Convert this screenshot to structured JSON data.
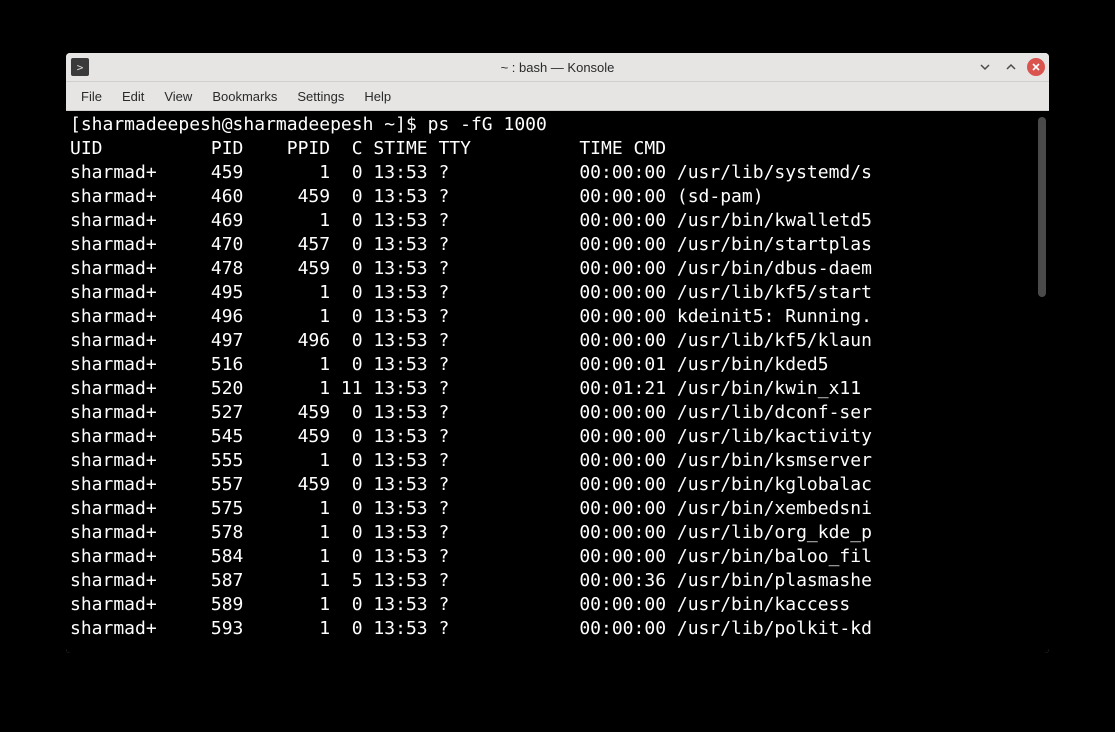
{
  "window": {
    "title": "~ : bash — Konsole",
    "app_icon_glyph": ">"
  },
  "menubar": {
    "items": [
      "File",
      "Edit",
      "View",
      "Bookmarks",
      "Settings",
      "Help"
    ]
  },
  "terminal": {
    "prompt": "[sharmadeepesh@sharmadeepesh ~]$ ",
    "command": "ps -fG 1000",
    "header": "UID          PID    PPID  C STIME TTY          TIME CMD",
    "rows": [
      {
        "uid": "sharmad+",
        "pid": "459",
        "ppid": "1",
        "c": "0",
        "stime": "13:53",
        "tty": "?",
        "time": "00:00:00",
        "cmd": "/usr/lib/systemd/s"
      },
      {
        "uid": "sharmad+",
        "pid": "460",
        "ppid": "459",
        "c": "0",
        "stime": "13:53",
        "tty": "?",
        "time": "00:00:00",
        "cmd": "(sd-pam)"
      },
      {
        "uid": "sharmad+",
        "pid": "469",
        "ppid": "1",
        "c": "0",
        "stime": "13:53",
        "tty": "?",
        "time": "00:00:00",
        "cmd": "/usr/bin/kwalletd5"
      },
      {
        "uid": "sharmad+",
        "pid": "470",
        "ppid": "457",
        "c": "0",
        "stime": "13:53",
        "tty": "?",
        "time": "00:00:00",
        "cmd": "/usr/bin/startplas"
      },
      {
        "uid": "sharmad+",
        "pid": "478",
        "ppid": "459",
        "c": "0",
        "stime": "13:53",
        "tty": "?",
        "time": "00:00:00",
        "cmd": "/usr/bin/dbus-daem"
      },
      {
        "uid": "sharmad+",
        "pid": "495",
        "ppid": "1",
        "c": "0",
        "stime": "13:53",
        "tty": "?",
        "time": "00:00:00",
        "cmd": "/usr/lib/kf5/start"
      },
      {
        "uid": "sharmad+",
        "pid": "496",
        "ppid": "1",
        "c": "0",
        "stime": "13:53",
        "tty": "?",
        "time": "00:00:00",
        "cmd": "kdeinit5: Running."
      },
      {
        "uid": "sharmad+",
        "pid": "497",
        "ppid": "496",
        "c": "0",
        "stime": "13:53",
        "tty": "?",
        "time": "00:00:00",
        "cmd": "/usr/lib/kf5/klaun"
      },
      {
        "uid": "sharmad+",
        "pid": "516",
        "ppid": "1",
        "c": "0",
        "stime": "13:53",
        "tty": "?",
        "time": "00:00:01",
        "cmd": "/usr/bin/kded5"
      },
      {
        "uid": "sharmad+",
        "pid": "520",
        "ppid": "1",
        "c": "11",
        "stime": "13:53",
        "tty": "?",
        "time": "00:01:21",
        "cmd": "/usr/bin/kwin_x11"
      },
      {
        "uid": "sharmad+",
        "pid": "527",
        "ppid": "459",
        "c": "0",
        "stime": "13:53",
        "tty": "?",
        "time": "00:00:00",
        "cmd": "/usr/lib/dconf-ser"
      },
      {
        "uid": "sharmad+",
        "pid": "545",
        "ppid": "459",
        "c": "0",
        "stime": "13:53",
        "tty": "?",
        "time": "00:00:00",
        "cmd": "/usr/lib/kactivity"
      },
      {
        "uid": "sharmad+",
        "pid": "555",
        "ppid": "1",
        "c": "0",
        "stime": "13:53",
        "tty": "?",
        "time": "00:00:00",
        "cmd": "/usr/bin/ksmserver"
      },
      {
        "uid": "sharmad+",
        "pid": "557",
        "ppid": "459",
        "c": "0",
        "stime": "13:53",
        "tty": "?",
        "time": "00:00:00",
        "cmd": "/usr/bin/kglobalac"
      },
      {
        "uid": "sharmad+",
        "pid": "575",
        "ppid": "1",
        "c": "0",
        "stime": "13:53",
        "tty": "?",
        "time": "00:00:00",
        "cmd": "/usr/bin/xembedsni"
      },
      {
        "uid": "sharmad+",
        "pid": "578",
        "ppid": "1",
        "c": "0",
        "stime": "13:53",
        "tty": "?",
        "time": "00:00:00",
        "cmd": "/usr/lib/org_kde_p"
      },
      {
        "uid": "sharmad+",
        "pid": "584",
        "ppid": "1",
        "c": "0",
        "stime": "13:53",
        "tty": "?",
        "time": "00:00:00",
        "cmd": "/usr/bin/baloo_fil"
      },
      {
        "uid": "sharmad+",
        "pid": "587",
        "ppid": "1",
        "c": "5",
        "stime": "13:53",
        "tty": "?",
        "time": "00:00:36",
        "cmd": "/usr/bin/plasmashe"
      },
      {
        "uid": "sharmad+",
        "pid": "589",
        "ppid": "1",
        "c": "0",
        "stime": "13:53",
        "tty": "?",
        "time": "00:00:00",
        "cmd": "/usr/bin/kaccess"
      },
      {
        "uid": "sharmad+",
        "pid": "593",
        "ppid": "1",
        "c": "0",
        "stime": "13:53",
        "tty": "?",
        "time": "00:00:00",
        "cmd": "/usr/lib/polkit-kd"
      }
    ]
  }
}
